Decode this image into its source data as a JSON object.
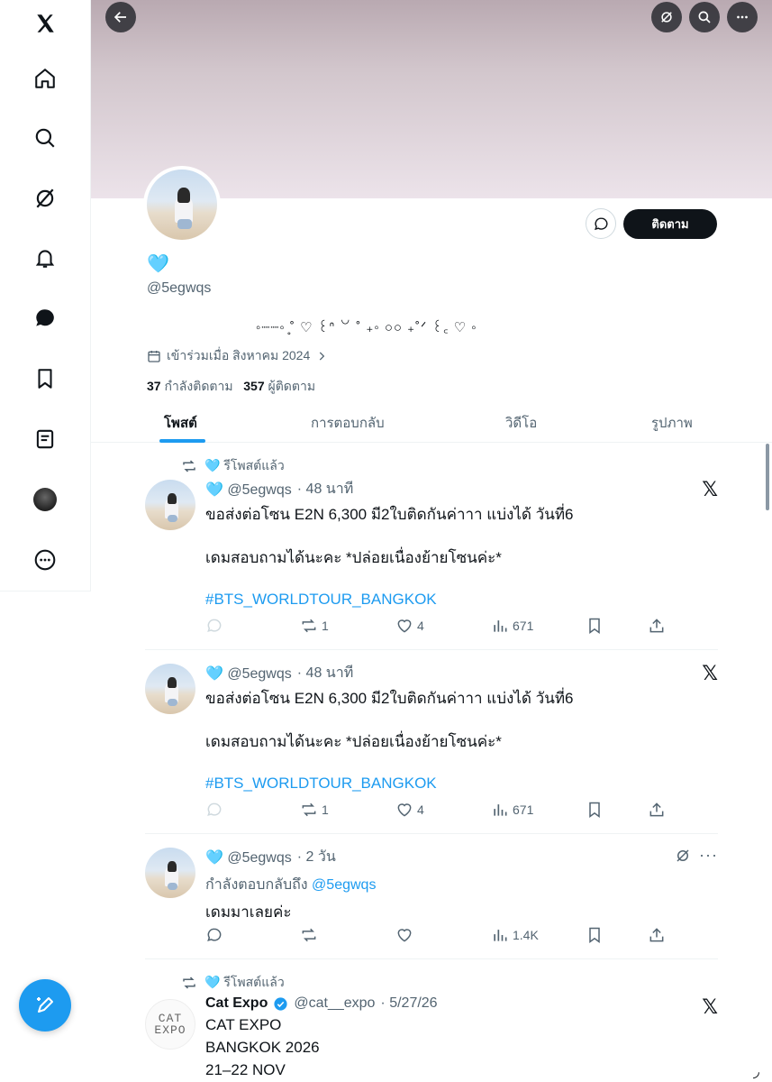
{
  "nav": {
    "items": [
      "x-logo",
      "home",
      "search",
      "grok",
      "notifications",
      "messages",
      "bookmarks",
      "lists",
      "profile",
      "more"
    ]
  },
  "profile": {
    "name_emoji": "🩵",
    "handle": "@5egwqs",
    "bio": "˚‧꒰ᐢ. ̫ .ᐢ꒱‧˚ ⊹ ˚₊‧꒰ა ☆ ໒꒱ ‧₊˚",
    "bio_display": "◦┈┈◦ ̥˚ ♡ ꒰ᐢ ꒡ ˚ ₊◦ ○○ ₊˚ᐟ ꒰꜀ ♡ ◦",
    "joined": "เข้าร่วมเมื่อ สิงหาคม 2024",
    "following_count": "37",
    "following_label": "กำลังติดตาม",
    "followers_count": "357",
    "followers_label": "ผู้ติดตาม",
    "follow_button": "ติดตาม"
  },
  "tabs": [
    "โพสต์",
    "การตอบกลับ",
    "วิดีโอ",
    "รูปภาพ"
  ],
  "posts": [
    {
      "repost_label": "🩵 รีโพสต์แล้ว",
      "author": "🩵 @5egwqs",
      "time": "· 48 นาที",
      "line1": "ขอส่งต่อโซน E2N 6,300 มี2ใบติดกันค่าาา แบ่งได้ วันที่6",
      "line2": "เดมสอบถามได้นะคะ *ปล่อยเนื่องย้ายโซนค่ะ*",
      "hashtag": "#BTS_WORLDTOUR_BANGKOK",
      "reposts": "1",
      "likes": "4",
      "views": "671"
    },
    {
      "author": "🩵 @5egwqs",
      "time": "· 48 นาที",
      "line1": "ขอส่งต่อโซน E2N 6,300 มี2ใบติดกันค่าาา แบ่งได้ วันที่6",
      "line2": "เดมสอบถามได้นะคะ *ปล่อยเนื่องย้ายโซนค่ะ*",
      "hashtag": "#BTS_WORLDTOUR_BANGKOK",
      "reposts": "1",
      "likes": "4",
      "views": "671"
    },
    {
      "author": "🩵 @5egwqs",
      "time": "· 2 วัน",
      "reply_prefix": "กำลังตอบกลับถึง",
      "reply_to": "@5egwqs",
      "text": "เดมมาเลยค่ะ",
      "views": "1.4K"
    },
    {
      "repost_label": "🩵 รีโพสต์แล้ว",
      "display_name": "Cat Expo",
      "author": "@cat__expo",
      "time": "· 5/27/26",
      "avatar_text": "CAT EXPO",
      "line1": "CAT EXPO",
      "line2": "BANGKOK 2026",
      "line3": "21–22 NOV"
    }
  ],
  "x_mark": "𝕏"
}
